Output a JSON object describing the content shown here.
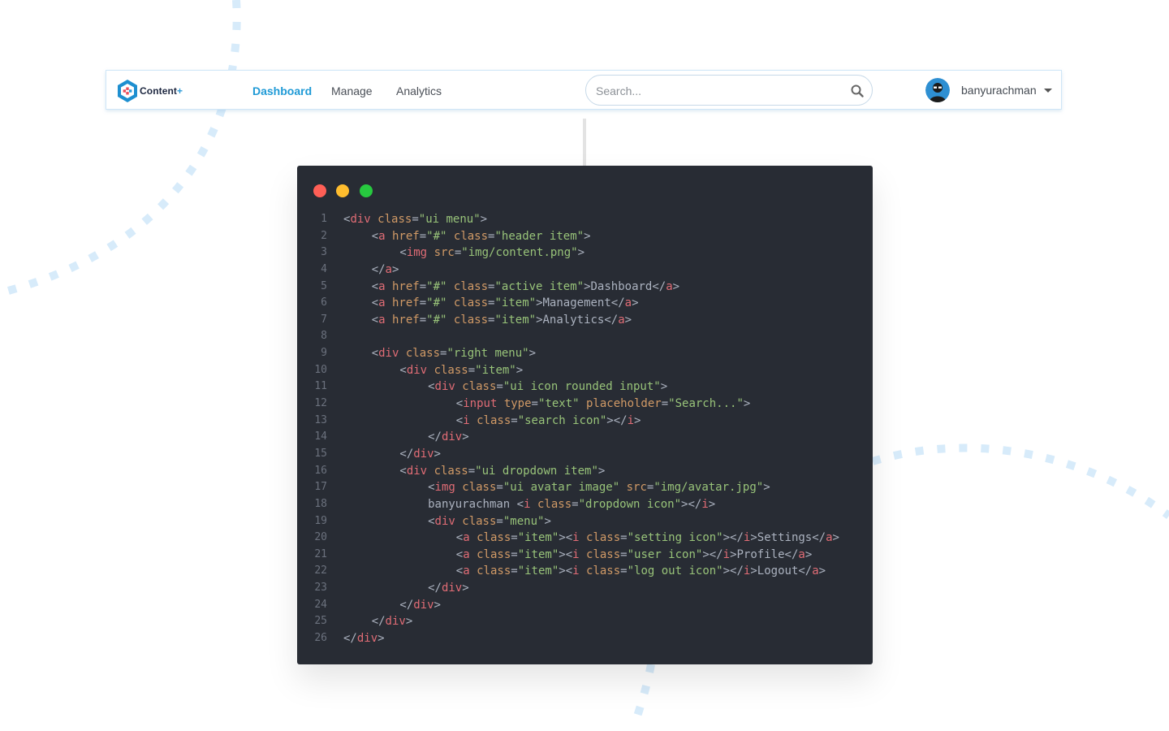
{
  "navbar": {
    "logo_text": "Content",
    "logo_plus": "+",
    "items": [
      {
        "label": "Dashboard",
        "active": true
      },
      {
        "label": "Manage",
        "active": false
      },
      {
        "label": "Analytics",
        "active": false
      }
    ],
    "search": {
      "placeholder": "Search...",
      "value": ""
    },
    "user": {
      "name": "banyurachman"
    }
  },
  "colors": {
    "accent": "#1f9ad6",
    "code_bg": "#282c34",
    "window_red": "#ff5f56",
    "window_yellow": "#ffbd2e",
    "window_green": "#27c93f"
  },
  "code_lines": [
    {
      "n": "1",
      "indent": 0,
      "tokens": [
        [
          "punc",
          "<"
        ],
        [
          "tag",
          "div"
        ],
        [
          "txt",
          " "
        ],
        [
          "attr",
          "class"
        ],
        [
          "punc",
          "="
        ],
        [
          "str",
          "\"ui menu\""
        ],
        [
          "punc",
          ">"
        ]
      ]
    },
    {
      "n": "2",
      "indent": 1,
      "tokens": [
        [
          "punc",
          "<"
        ],
        [
          "tag",
          "a"
        ],
        [
          "txt",
          " "
        ],
        [
          "attr",
          "href"
        ],
        [
          "punc",
          "="
        ],
        [
          "str",
          "\"#\""
        ],
        [
          "txt",
          " "
        ],
        [
          "attr",
          "class"
        ],
        [
          "punc",
          "="
        ],
        [
          "str",
          "\"header item\""
        ],
        [
          "punc",
          ">"
        ]
      ]
    },
    {
      "n": "3",
      "indent": 2,
      "tokens": [
        [
          "punc",
          "<"
        ],
        [
          "tag",
          "img"
        ],
        [
          "txt",
          " "
        ],
        [
          "attr",
          "src"
        ],
        [
          "punc",
          "="
        ],
        [
          "str",
          "\"img/content.png\""
        ],
        [
          "punc",
          ">"
        ]
      ]
    },
    {
      "n": "4",
      "indent": 1,
      "tokens": [
        [
          "punc",
          "</"
        ],
        [
          "tag",
          "a"
        ],
        [
          "punc",
          ">"
        ]
      ]
    },
    {
      "n": "5",
      "indent": 1,
      "tokens": [
        [
          "punc",
          "<"
        ],
        [
          "tag",
          "a"
        ],
        [
          "txt",
          " "
        ],
        [
          "attr",
          "href"
        ],
        [
          "punc",
          "="
        ],
        [
          "str",
          "\"#\""
        ],
        [
          "txt",
          " "
        ],
        [
          "attr",
          "class"
        ],
        [
          "punc",
          "="
        ],
        [
          "str",
          "\"active item\""
        ],
        [
          "punc",
          ">"
        ],
        [
          "txt",
          "Dashboard"
        ],
        [
          "punc",
          "</"
        ],
        [
          "tag",
          "a"
        ],
        [
          "punc",
          ">"
        ]
      ]
    },
    {
      "n": "6",
      "indent": 1,
      "tokens": [
        [
          "punc",
          "<"
        ],
        [
          "tag",
          "a"
        ],
        [
          "txt",
          " "
        ],
        [
          "attr",
          "href"
        ],
        [
          "punc",
          "="
        ],
        [
          "str",
          "\"#\""
        ],
        [
          "txt",
          " "
        ],
        [
          "attr",
          "class"
        ],
        [
          "punc",
          "="
        ],
        [
          "str",
          "\"item\""
        ],
        [
          "punc",
          ">"
        ],
        [
          "txt",
          "Management"
        ],
        [
          "punc",
          "</"
        ],
        [
          "tag",
          "a"
        ],
        [
          "punc",
          ">"
        ]
      ]
    },
    {
      "n": "7",
      "indent": 1,
      "tokens": [
        [
          "punc",
          "<"
        ],
        [
          "tag",
          "a"
        ],
        [
          "txt",
          " "
        ],
        [
          "attr",
          "href"
        ],
        [
          "punc",
          "="
        ],
        [
          "str",
          "\"#\""
        ],
        [
          "txt",
          " "
        ],
        [
          "attr",
          "class"
        ],
        [
          "punc",
          "="
        ],
        [
          "str",
          "\"item\""
        ],
        [
          "punc",
          ">"
        ],
        [
          "txt",
          "Analytics"
        ],
        [
          "punc",
          "</"
        ],
        [
          "tag",
          "a"
        ],
        [
          "punc",
          ">"
        ]
      ]
    },
    {
      "n": "8",
      "indent": 0,
      "tokens": []
    },
    {
      "n": "9",
      "indent": 1,
      "tokens": [
        [
          "punc",
          "<"
        ],
        [
          "tag",
          "div"
        ],
        [
          "txt",
          " "
        ],
        [
          "attr",
          "class"
        ],
        [
          "punc",
          "="
        ],
        [
          "str",
          "\"right menu\""
        ],
        [
          "punc",
          ">"
        ]
      ]
    },
    {
      "n": "10",
      "indent": 2,
      "tokens": [
        [
          "punc",
          "<"
        ],
        [
          "tag",
          "div"
        ],
        [
          "txt",
          " "
        ],
        [
          "attr",
          "class"
        ],
        [
          "punc",
          "="
        ],
        [
          "str",
          "\"item\""
        ],
        [
          "punc",
          ">"
        ]
      ]
    },
    {
      "n": "11",
      "indent": 3,
      "tokens": [
        [
          "punc",
          "<"
        ],
        [
          "tag",
          "div"
        ],
        [
          "txt",
          " "
        ],
        [
          "attr",
          "class"
        ],
        [
          "punc",
          "="
        ],
        [
          "str",
          "\"ui icon rounded input\""
        ],
        [
          "punc",
          ">"
        ]
      ]
    },
    {
      "n": "12",
      "indent": 4,
      "tokens": [
        [
          "punc",
          "<"
        ],
        [
          "tag",
          "input"
        ],
        [
          "txt",
          " "
        ],
        [
          "attr",
          "type"
        ],
        [
          "punc",
          "="
        ],
        [
          "str",
          "\"text\""
        ],
        [
          "txt",
          " "
        ],
        [
          "attr",
          "placeholder"
        ],
        [
          "punc",
          "="
        ],
        [
          "str",
          "\"Search...\""
        ],
        [
          "punc",
          ">"
        ]
      ]
    },
    {
      "n": "13",
      "indent": 4,
      "tokens": [
        [
          "punc",
          "<"
        ],
        [
          "tag",
          "i"
        ],
        [
          "txt",
          " "
        ],
        [
          "attr",
          "class"
        ],
        [
          "punc",
          "="
        ],
        [
          "str",
          "\"search icon\""
        ],
        [
          "punc",
          "></"
        ],
        [
          "tag",
          "i"
        ],
        [
          "punc",
          ">"
        ]
      ]
    },
    {
      "n": "14",
      "indent": 3,
      "tokens": [
        [
          "punc",
          "</"
        ],
        [
          "tag",
          "div"
        ],
        [
          "punc",
          ">"
        ]
      ]
    },
    {
      "n": "15",
      "indent": 2,
      "tokens": [
        [
          "punc",
          "</"
        ],
        [
          "tag",
          "div"
        ],
        [
          "punc",
          ">"
        ]
      ]
    },
    {
      "n": "16",
      "indent": 2,
      "tokens": [
        [
          "punc",
          "<"
        ],
        [
          "tag",
          "div"
        ],
        [
          "txt",
          " "
        ],
        [
          "attr",
          "class"
        ],
        [
          "punc",
          "="
        ],
        [
          "str",
          "\"ui dropdown item\""
        ],
        [
          "punc",
          ">"
        ]
      ]
    },
    {
      "n": "17",
      "indent": 3,
      "tokens": [
        [
          "punc",
          "<"
        ],
        [
          "tag",
          "img"
        ],
        [
          "txt",
          " "
        ],
        [
          "attr",
          "class"
        ],
        [
          "punc",
          "="
        ],
        [
          "str",
          "\"ui avatar image\""
        ],
        [
          "txt",
          " "
        ],
        [
          "attr",
          "src"
        ],
        [
          "punc",
          "="
        ],
        [
          "str",
          "\"img/avatar.jpg\""
        ],
        [
          "punc",
          ">"
        ]
      ]
    },
    {
      "n": "18",
      "indent": 3,
      "tokens": [
        [
          "txt",
          "banyurachman "
        ],
        [
          "punc",
          "<"
        ],
        [
          "tag",
          "i"
        ],
        [
          "txt",
          " "
        ],
        [
          "attr",
          "class"
        ],
        [
          "punc",
          "="
        ],
        [
          "str",
          "\"dropdown icon\""
        ],
        [
          "punc",
          "></"
        ],
        [
          "tag",
          "i"
        ],
        [
          "punc",
          ">"
        ]
      ]
    },
    {
      "n": "19",
      "indent": 3,
      "tokens": [
        [
          "punc",
          "<"
        ],
        [
          "tag",
          "div"
        ],
        [
          "txt",
          " "
        ],
        [
          "attr",
          "class"
        ],
        [
          "punc",
          "="
        ],
        [
          "str",
          "\"menu\""
        ],
        [
          "punc",
          ">"
        ]
      ]
    },
    {
      "n": "20",
      "indent": 4,
      "tokens": [
        [
          "punc",
          "<"
        ],
        [
          "tag",
          "a"
        ],
        [
          "txt",
          " "
        ],
        [
          "attr",
          "class"
        ],
        [
          "punc",
          "="
        ],
        [
          "str",
          "\"item\""
        ],
        [
          "punc",
          "><"
        ],
        [
          "tag",
          "i"
        ],
        [
          "txt",
          " "
        ],
        [
          "attr",
          "class"
        ],
        [
          "punc",
          "="
        ],
        [
          "str",
          "\"setting icon\""
        ],
        [
          "punc",
          "></"
        ],
        [
          "tag",
          "i"
        ],
        [
          "punc",
          ">"
        ],
        [
          "txt",
          "Settings"
        ],
        [
          "punc",
          "</"
        ],
        [
          "tag",
          "a"
        ],
        [
          "punc",
          ">"
        ]
      ]
    },
    {
      "n": "21",
      "indent": 4,
      "tokens": [
        [
          "punc",
          "<"
        ],
        [
          "tag",
          "a"
        ],
        [
          "txt",
          " "
        ],
        [
          "attr",
          "class"
        ],
        [
          "punc",
          "="
        ],
        [
          "str",
          "\"item\""
        ],
        [
          "punc",
          "><"
        ],
        [
          "tag",
          "i"
        ],
        [
          "txt",
          " "
        ],
        [
          "attr",
          "class"
        ],
        [
          "punc",
          "="
        ],
        [
          "str",
          "\"user icon\""
        ],
        [
          "punc",
          "></"
        ],
        [
          "tag",
          "i"
        ],
        [
          "punc",
          ">"
        ],
        [
          "txt",
          "Profile"
        ],
        [
          "punc",
          "</"
        ],
        [
          "tag",
          "a"
        ],
        [
          "punc",
          ">"
        ]
      ]
    },
    {
      "n": "22",
      "indent": 4,
      "tokens": [
        [
          "punc",
          "<"
        ],
        [
          "tag",
          "a"
        ],
        [
          "txt",
          " "
        ],
        [
          "attr",
          "class"
        ],
        [
          "punc",
          "="
        ],
        [
          "str",
          "\"item\""
        ],
        [
          "punc",
          "><"
        ],
        [
          "tag",
          "i"
        ],
        [
          "txt",
          " "
        ],
        [
          "attr",
          "class"
        ],
        [
          "punc",
          "="
        ],
        [
          "str",
          "\"log out icon\""
        ],
        [
          "punc",
          "></"
        ],
        [
          "tag",
          "i"
        ],
        [
          "punc",
          ">"
        ],
        [
          "txt",
          "Logout"
        ],
        [
          "punc",
          "</"
        ],
        [
          "tag",
          "a"
        ],
        [
          "punc",
          ">"
        ]
      ]
    },
    {
      "n": "23",
      "indent": 3,
      "tokens": [
        [
          "punc",
          "</"
        ],
        [
          "tag",
          "div"
        ],
        [
          "punc",
          ">"
        ]
      ]
    },
    {
      "n": "24",
      "indent": 2,
      "tokens": [
        [
          "punc",
          "</"
        ],
        [
          "tag",
          "div"
        ],
        [
          "punc",
          ">"
        ]
      ]
    },
    {
      "n": "25",
      "indent": 1,
      "tokens": [
        [
          "punc",
          "</"
        ],
        [
          "tag",
          "div"
        ],
        [
          "punc",
          ">"
        ]
      ]
    },
    {
      "n": "26",
      "indent": 0,
      "tokens": [
        [
          "punc",
          "</"
        ],
        [
          "tag",
          "div"
        ],
        [
          "punc",
          ">"
        ]
      ]
    }
  ]
}
